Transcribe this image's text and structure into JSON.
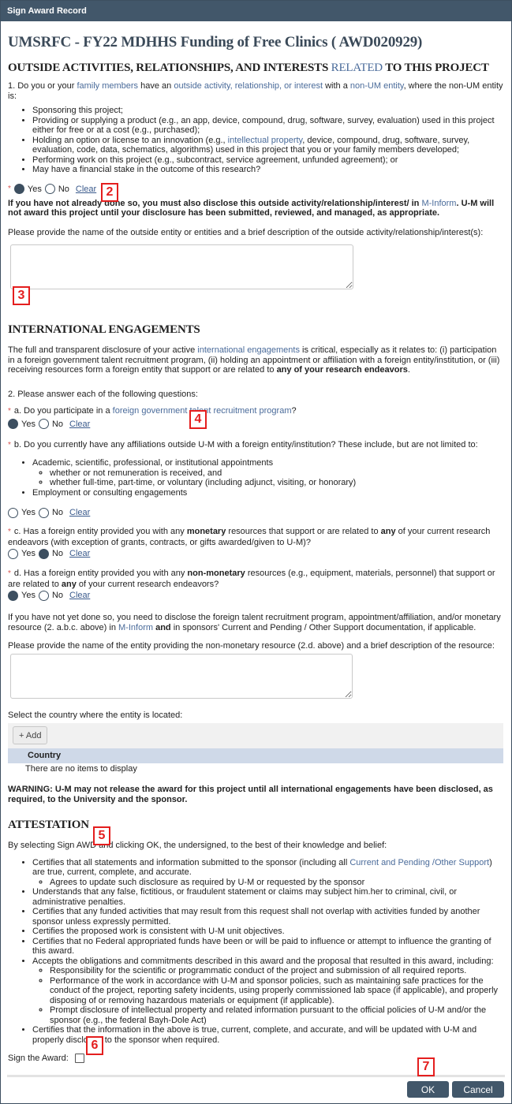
{
  "window": {
    "title": "Sign Award Record"
  },
  "award": {
    "title": "UMSRFC - FY22 MDHHS Funding of Free Clinics ( AWD020929)"
  },
  "outside": {
    "heading_pre": "OUTSIDE ACTIVITIES, RELATIONSHIPS, AND INTERESTS ",
    "heading_link": "RELATED",
    "heading_post": " TO THIS PROJECT",
    "q1": {
      "t1": "1. Do you or your ",
      "link1": "family members",
      "t2": " have an ",
      "link2": "outside activity, relationship, or interest",
      "t3": " with a ",
      "link3": "non-UM entity",
      "t4": ", where the non-UM entity is:"
    },
    "bullets": [
      "Sponsoring this project;",
      "Providing or supplying a product (e.g., an app, device, compound, drug, software, survey, evaluation) used in this project either for free or at a cost (e.g., purchased);",
      "Holding an option or license to an innovation (e.g., ",
      "Performing work on this project (e.g., subcontract, service agreement, unfunded agreement); or",
      "May have a financial stake in the outcome of this research?"
    ],
    "bullet3_link": "intellectual property",
    "bullet3_rest": ", device, compound, drug, software, survey, evaluation, code, data, schematics, algorithms) used in this project that you or your family members developed;",
    "answer": {
      "yes": "Yes",
      "no": "No",
      "clear": "Clear",
      "selected": "Yes"
    },
    "notice_pre": "If you have not already done so, you must also disclose this outside activity/relationship/interest/ in ",
    "notice_link": "M-Inform",
    "notice_post": ". U-M will not award this project until your disclosure has been submitted, reviewed, and managed, as appropriate.",
    "desc_label": "Please provide the name of the outside entity or entities and a brief description of the outside activity/relationship/interest(s):",
    "desc_value": ""
  },
  "international": {
    "heading": "INTERNATIONAL ENGAGEMENTS",
    "intro_pre": "The full and transparent disclosure of your active ",
    "intro_link": "international engagements",
    "intro_mid": " is critical, especially as it relates to: (i) participation in a foreign government talent recruitment program, (ii) holding an appointment or affiliation with a foreign entity/institution, or (iii) receiving resources form a foreign entity that support or are related to ",
    "intro_bold": "any of your research endeavors",
    "intro_end": ".",
    "q2": "2. Please answer each of the following questions:",
    "qa": {
      "pre": "a. Do you participate in a ",
      "link": "foreign government talent recruitment program",
      "post": "?",
      "selected": "Yes"
    },
    "qb": {
      "text": "b. Do you currently have any affiliations outside U-M with a foreign entity/institution? These include, but are not limited to:",
      "bullet1": "Academic, scientific, professional, or institutional appointments",
      "sub1": "whether or not remuneration is received, and",
      "sub2": "whether full-time, part-time, or voluntary (including adjunct, visiting, or honorary)",
      "bullet2": "Employment or consulting engagements",
      "selected": ""
    },
    "qc": {
      "pre": "c. Has a foreign entity provided you with any ",
      "bold1": "monetary",
      "mid": " resources that support or are related to ",
      "bold2": "any",
      "post": " of your current research endeavors (with exception of grants, contracts, or gifts awarded/given to U-M)?",
      "selected": "No"
    },
    "qd": {
      "pre": "d. Has a foreign entity provided you with any ",
      "bold1": "non-monetary",
      "mid": " resources (e.g., equipment, materials, personnel) that support or are related to ",
      "bold2": "any",
      "post": " of your current research endeavors?",
      "selected": "Yes"
    },
    "yes": "Yes",
    "no": "No",
    "clear": "Clear",
    "notice_pre": "If you have not yet done so, you need to disclose the foreign talent recruitment program, appointment/affiliation, and/or monetary resource (2. a.b.c. above) in ",
    "notice_link": "M-Inform",
    "notice_bold": " and",
    "notice_post": " in sponsors' Current and Pending / Other Support documentation, if applicable.",
    "desc_label": "Please provide the name of the entity providing the non-monetary resource (2.d. above) and a brief description of the resource:",
    "desc_value": "",
    "country_label": "Select the country where the entity is located:",
    "add_button": "+ Add",
    "grid_header": "Country",
    "grid_empty": "There are no items to display",
    "warning": "WARNING: U-M may not release the award for this project until all international engagements have been disclosed, as required, to the University and the sponsor."
  },
  "attestation": {
    "heading": "ATTESTATION",
    "intro": "By selecting Sign AWD and clicking OK, the undersigned, to the best of their knowledge and belief:",
    "b1_pre": "Certifies that all statements and information submitted to the sponsor (including all ",
    "b1_link": "Current and Pending /Other Support",
    "b1_post": ") are true, current, complete, and accurate.",
    "b1_sub": "Agrees to update such disclosure as required by U-M or requested by the sponsor",
    "b2": "Understands that any false, fictitious, or fraudulent statement or claims may subject him.her to criminal, civil, or administrative penalties.",
    "b3": "Certifies that any funded activities that may result from this request shall not overlap with activities funded by another sponsor unless expressly permitted.",
    "b4": "Certifies the proposed work is consistent with U-M unit objectives.",
    "b5": "Certifies that no Federal appropriated funds have been or will be paid to influence or attempt to influence the granting of this award.",
    "b6": "Accepts the obligations and commitments described in this award and the proposal that resulted in this award, including:",
    "b6_sub1": "Responsibility for the scientific or programmatic conduct of the project and submission of all required reports.",
    "b6_sub2": "Performance of the work in accordance with U-M and sponsor policies, such as maintaining safe practices for the conduct of the project, reporting safety incidents, using properly commissioned lab space (if applicable), and properly disposing of or removing hazardous materials or equipment (if applicable).",
    "b6_sub3": "Prompt disclosure of intellectual property and related information pursuant to the official policies of U-M and/or the sponsor (e.g., the federal Bayh-Dole Act)",
    "b7": "Certifies that the information in the above is true, current, complete, and accurate, and will be updated with U-M and properly disclosed to the sponsor when required.",
    "sign_label": "Sign the Award:",
    "signed": false
  },
  "footer": {
    "ok": "OK",
    "cancel": "Cancel"
  },
  "callouts": {
    "c2": "2",
    "c3": "3",
    "c4": "4",
    "c5": "5",
    "c6": "6",
    "c7": "7"
  },
  "colors": {
    "titlebar": "#42576a",
    "link": "#4a6b9a",
    "callout": "#e41e1e",
    "grid_header": "#cfd9e8"
  }
}
